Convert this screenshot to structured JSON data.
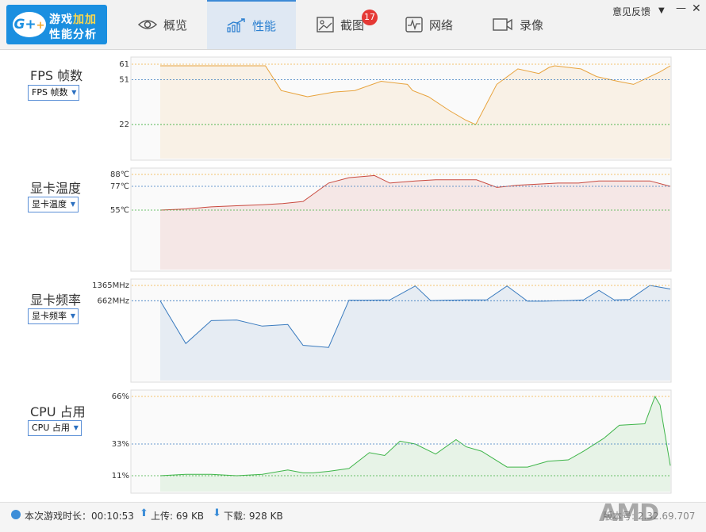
{
  "app": {
    "logo_line1_a": "游戏",
    "logo_line1_b": "加加",
    "logo_line2": "性能分析",
    "logo_badge": "G+"
  },
  "tabs": [
    {
      "label": "概览",
      "icon": "eye-icon"
    },
    {
      "label": "性能",
      "icon": "trend-chart-icon",
      "active": true
    },
    {
      "label": "截图",
      "icon": "image-icon",
      "badge": "17"
    },
    {
      "label": "网络",
      "icon": "pulse-icon"
    },
    {
      "label": "录像",
      "icon": "video-camera-icon"
    }
  ],
  "header": {
    "feedback": "意见反馈",
    "menu_arrow": "▼",
    "minimize": "—",
    "close": "✕"
  },
  "colors": {
    "fps": "#e8a33d",
    "temp": "#c94a3f",
    "freq": "#3a7bbf",
    "cpu": "#3fb54a",
    "accent": "#1a8fe0"
  },
  "panels": [
    {
      "title": "FPS 帧数",
      "select": "FPS 帧数"
    },
    {
      "title": "显卡温度",
      "select": "显卡温度"
    },
    {
      "title": "显卡频率",
      "select": "显卡频率"
    },
    {
      "title": "CPU 占用",
      "select": "CPU 占用"
    }
  ],
  "chart_data": [
    {
      "type": "area",
      "title": "FPS 帧数",
      "reference_lines": [
        61,
        51,
        22
      ],
      "tick_labels": [
        "61",
        "51",
        "22"
      ],
      "ylim": [
        0,
        61
      ],
      "x": [
        0,
        7,
        14,
        20,
        23,
        28,
        33,
        37,
        42,
        47,
        48,
        51,
        55,
        58,
        60,
        64,
        68,
        72,
        74,
        75,
        80,
        83,
        87,
        90,
        95,
        97
      ],
      "values": [
        60,
        60,
        60,
        60,
        44,
        40,
        43,
        44,
        50,
        48,
        44,
        40,
        31,
        25,
        22,
        48,
        58,
        55,
        59,
        60,
        58,
        53,
        50,
        48,
        56,
        60
      ]
    },
    {
      "type": "area",
      "title": "显卡温度",
      "reference_lines": [
        88,
        77,
        55
      ],
      "tick_labels": [
        "88℃",
        "77℃",
        "55℃"
      ],
      "ylim": [
        0,
        88
      ],
      "x": [
        0,
        5,
        10,
        15,
        20,
        24,
        28,
        33,
        37,
        42,
        45,
        50,
        54,
        58,
        62,
        66,
        70,
        74,
        78,
        82,
        86,
        90,
        96,
        100
      ],
      "values": [
        55,
        56,
        58,
        59,
        60,
        61,
        63,
        80,
        85,
        87,
        80,
        82,
        83,
        83,
        83,
        76,
        78,
        79,
        80,
        80,
        82,
        82,
        82,
        77
      ]
    },
    {
      "type": "area",
      "title": "显卡频率",
      "reference_lines": [
        1365,
        662
      ],
      "tick_labels": [
        "1365MHz",
        "662MHz"
      ],
      "ylim": [
        -3000,
        1365
      ],
      "x": [
        0,
        5,
        10,
        15,
        20,
        25,
        28,
        33,
        37,
        40,
        45,
        50,
        53,
        56,
        60,
        64,
        68,
        72,
        75,
        80,
        83,
        86,
        89,
        92,
        96,
        100
      ],
      "values": [
        660,
        -1300,
        -250,
        -220,
        -500,
        -430,
        -1380,
        -1480,
        690,
        690,
        700,
        1340,
        670,
        690,
        700,
        700,
        1340,
        640,
        640,
        670,
        700,
        1140,
        700,
        720,
        1365,
        1200
      ]
    },
    {
      "type": "area",
      "title": "CPU 占用",
      "reference_lines": [
        66,
        33,
        11
      ],
      "tick_labels": [
        "66%",
        "33%",
        "11%"
      ],
      "ylim": [
        0,
        66
      ],
      "x": [
        0,
        5,
        10,
        15,
        20,
        25,
        28,
        30,
        33,
        37,
        41,
        44,
        47,
        50,
        54,
        58,
        60,
        63,
        68,
        72,
        76,
        80,
        83,
        87,
        90,
        95,
        97,
        98,
        100
      ],
      "values": [
        11,
        12,
        12,
        11,
        12,
        15,
        13,
        13,
        14,
        16,
        27,
        25,
        35,
        33,
        26,
        36,
        31,
        28,
        17,
        17,
        21,
        22,
        28,
        37,
        46,
        47,
        66,
        60,
        18
      ]
    }
  ],
  "footer": {
    "session_label": "本次游戏时长：00:10:53",
    "upload": "上传: 69 KB",
    "download": "下载: 928 KB",
    "version": "版本号: 2.32.69.707"
  },
  "watermark": "AMD"
}
